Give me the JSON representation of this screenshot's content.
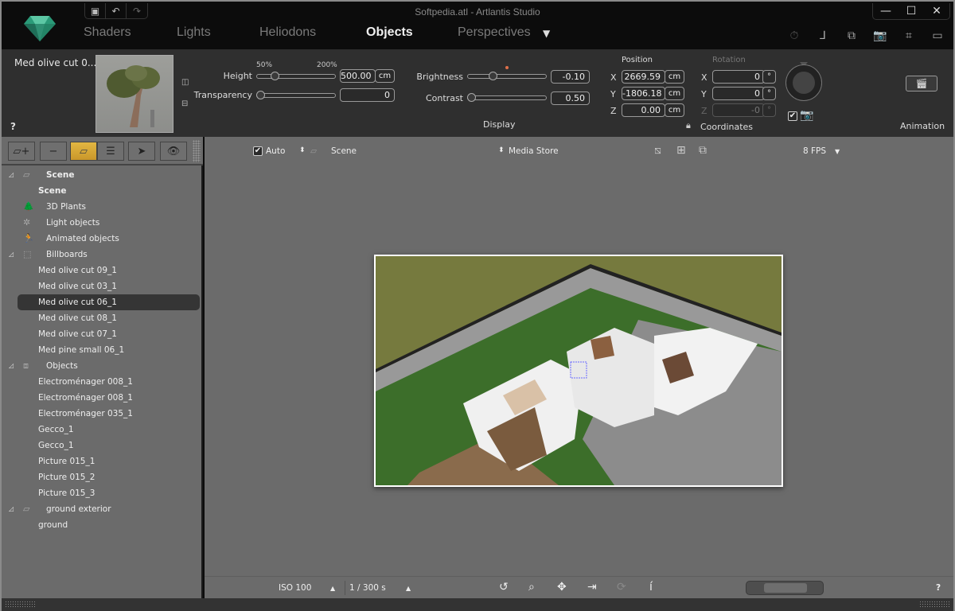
{
  "window": {
    "title": "Softpedia.atl - Artlantis Studio"
  },
  "quick_access": [
    {
      "name": "save-icon",
      "glyph": "💾"
    },
    {
      "name": "undo-icon",
      "glyph": "↶"
    },
    {
      "name": "redo-icon",
      "glyph": "↷"
    }
  ],
  "tabs": [
    {
      "label": "Shaders",
      "active": false
    },
    {
      "label": "Lights",
      "active": false
    },
    {
      "label": "Heliodons",
      "active": false
    },
    {
      "label": "Objects",
      "active": true
    },
    {
      "label": "Perspectives",
      "active": false
    }
  ],
  "tab_dropdown_glyph": "▼",
  "window_controls": {
    "minimize": "—",
    "maximize": "☐",
    "close": "✕"
  },
  "toolbar_right": [
    {
      "name": "timer-icon",
      "glyph": "⏱"
    },
    {
      "name": "axes-icon",
      "glyph": "⅃"
    },
    {
      "name": "windows-icon",
      "glyph": "⧉"
    },
    {
      "name": "camera-icon",
      "glyph": "📷"
    },
    {
      "name": "crop-icon",
      "glyph": "⌗"
    },
    {
      "name": "monitor-icon",
      "glyph": "▭"
    }
  ],
  "properties": {
    "object_name": "Med olive cut 0...",
    "help": "?",
    "height": {
      "label": "Height",
      "value": "500.00",
      "unit": "cm",
      "min_label": "50%",
      "max_label": "200%",
      "slider_fraction": 0.2
    },
    "transparency": {
      "label": "Transparency",
      "value": "0",
      "slider_fraction": 0.0
    },
    "brightness": {
      "label": "Brightness",
      "value": "-0.10",
      "slider_fraction": 0.3
    },
    "contrast": {
      "label": "Contrast",
      "value": "0.50",
      "slider_fraction": 0.0
    },
    "display_label": "Display",
    "position": {
      "label": "Position",
      "x": "2669.59",
      "y": "-1806.18",
      "z": "0.00",
      "unit": "cm"
    },
    "rotation": {
      "label": "Rotation",
      "x": "0",
      "y": "0",
      "z": "-0",
      "unit": "°"
    },
    "axis_labels": {
      "x": "X",
      "y": "Y",
      "z": "Z"
    },
    "coordinates_label": "Coordinates",
    "animation_label": "Animation",
    "camera_checkbox": true
  },
  "left_toolbar": [
    {
      "name": "add-plane-button",
      "glyph": "▱+"
    },
    {
      "name": "remove-button",
      "glyph": "−"
    },
    {
      "name": "plane-view-button",
      "glyph": "▱",
      "active": true
    },
    {
      "name": "list-view-button",
      "glyph": "☰"
    },
    {
      "name": "select-tool-button",
      "glyph": "➤"
    },
    {
      "name": "visibility-button",
      "glyph": "👁"
    }
  ],
  "tree": [
    {
      "label": "Scene",
      "type": "group",
      "bold": true,
      "icon": "▱"
    },
    {
      "label": "Scene",
      "type": "child",
      "bold": true
    },
    {
      "label": "3D Plants",
      "type": "category",
      "icon": "🌲"
    },
    {
      "label": "Light objects",
      "type": "category",
      "icon": "✲"
    },
    {
      "label": "Animated objects",
      "type": "category",
      "icon": "🏃"
    },
    {
      "label": "Billboards",
      "type": "group",
      "icon": "⬚"
    },
    {
      "label": "Med olive cut 09_1",
      "type": "child"
    },
    {
      "label": "Med olive cut 03_1",
      "type": "child"
    },
    {
      "label": "Med olive cut 06_1",
      "type": "child",
      "selected": true
    },
    {
      "label": "Med olive cut 08_1",
      "type": "child"
    },
    {
      "label": "Med olive cut 07_1",
      "type": "child"
    },
    {
      "label": "Med pine small 06_1",
      "type": "child"
    },
    {
      "label": "Objects",
      "type": "group",
      "icon": "⧈"
    },
    {
      "label": "Electroménager 008_1",
      "type": "child"
    },
    {
      "label": "Electroménager 008_1",
      "type": "child"
    },
    {
      "label": "Electroménager 035_1",
      "type": "child"
    },
    {
      "label": "Gecco_1",
      "type": "child"
    },
    {
      "label": "Gecco_1",
      "type": "child"
    },
    {
      "label": "Picture 015_1",
      "type": "child"
    },
    {
      "label": "Picture 015_2",
      "type": "child"
    },
    {
      "label": "Picture 015_3",
      "type": "child"
    },
    {
      "label": "ground exterior",
      "type": "group",
      "icon": "▱"
    },
    {
      "label": "ground",
      "type": "child"
    }
  ],
  "viewport_toolbar": {
    "auto_label": "Auto",
    "auto_checked": true,
    "scene_label": "Scene",
    "media_store_label": "Media Store",
    "fps_label": "8 FPS"
  },
  "bottom_toolbar": {
    "iso_label": "ISO 100",
    "shutter_label": "1 / 300 s",
    "help": "?"
  },
  "colors": {
    "accent": "#d9a93a",
    "panel": "#2f2f2f",
    "sidebar": "#6b6b6b",
    "topbar": "#0c0c0c"
  }
}
